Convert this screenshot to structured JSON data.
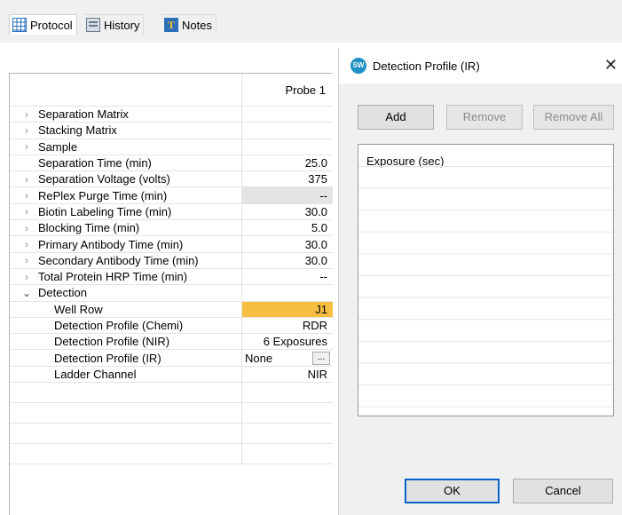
{
  "tabs": [
    {
      "label": "Protocol",
      "icon": "grid-icon",
      "active": true
    },
    {
      "label": "History",
      "icon": "history-icon",
      "active": false
    },
    {
      "label": "Notes",
      "icon": "notes-icon",
      "active": false
    }
  ],
  "grid": {
    "column_header": "Probe 1",
    "rows": [
      {
        "label": "Separation Matrix",
        "value": "",
        "expander": "collapsed"
      },
      {
        "label": "Stacking Matrix",
        "value": "",
        "expander": "collapsed"
      },
      {
        "label": "Sample",
        "value": "",
        "expander": "collapsed"
      },
      {
        "label": "Separation Time (min)",
        "value": "25.0",
        "expander": "none"
      },
      {
        "label": "Separation Voltage (volts)",
        "value": "375",
        "expander": "collapsed"
      },
      {
        "label": "RePlex Purge Time (min)",
        "value": "--",
        "expander": "collapsed",
        "highlight": "grey"
      },
      {
        "label": "Biotin Labeling Time (min)",
        "value": "30.0",
        "expander": "collapsed"
      },
      {
        "label": "Blocking Time (min)",
        "value": "5.0",
        "expander": "collapsed"
      },
      {
        "label": "Primary Antibody Time (min)",
        "value": "30.0",
        "expander": "collapsed"
      },
      {
        "label": "Secondary Antibody Time (min)",
        "value": "30.0",
        "expander": "collapsed"
      },
      {
        "label": "Total Protein HRP Time (min)",
        "value": "--",
        "expander": "collapsed"
      },
      {
        "label": "Detection",
        "value": "",
        "expander": "expanded"
      },
      {
        "label": "Well Row",
        "value": "J1",
        "child": true,
        "highlight": "orange"
      },
      {
        "label": "Detection Profile (Chemi)",
        "value": "RDR",
        "child": true
      },
      {
        "label": "Detection Profile (NIR)",
        "value": "6 Exposures",
        "child": true
      },
      {
        "label": "Detection Profile (IR)",
        "value": "None",
        "child": true,
        "button": "..."
      },
      {
        "label": "Ladder Channel",
        "value": "NIR",
        "child": true
      }
    ]
  },
  "dialog": {
    "title": "Detection Profile (IR)",
    "app_icon_text": "SW",
    "close": "✕",
    "buttons": {
      "add": "Add",
      "remove": "Remove",
      "remove_all": "Remove All",
      "ok": "OK",
      "cancel": "Cancel"
    },
    "list_header": "Exposure (sec)"
  },
  "colors": {
    "highlight_orange": "#f6bf41",
    "highlight_grey": "#e4e4e4",
    "accent_blue": "#0a64c8"
  }
}
